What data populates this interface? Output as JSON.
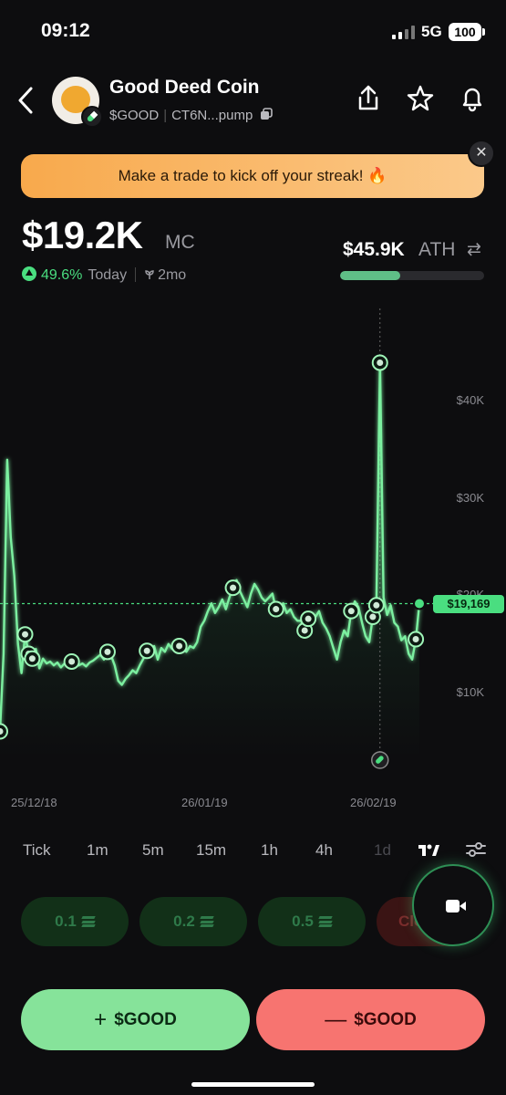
{
  "status_bar": {
    "time": "09:12",
    "network": "5G",
    "battery": "100"
  },
  "coin": {
    "name": "Good Deed Coin",
    "ticker": "$GOOD",
    "address": "CT6N...pump"
  },
  "banner": {
    "text": "Make a trade to kick off your streak! 🔥",
    "close": "✕"
  },
  "market_cap": {
    "value": "$19.2K",
    "label": "MC",
    "change_pct": "49.6%",
    "change_period": "Today",
    "age": "2mo"
  },
  "ath": {
    "value": "$45.9K",
    "label": "ATH",
    "progress": 0.42
  },
  "chart_data": {
    "type": "line",
    "y_ticks": [
      "$40K",
      "$30K",
      "$20K",
      "$10K"
    ],
    "x_ticks": [
      "25/12/18",
      "26/01/19",
      "26/02/19"
    ],
    "ylim": [
      0,
      48000
    ],
    "current_price_label": "$19,169",
    "current_price": 19169,
    "x": [
      0,
      1,
      2,
      3,
      4,
      5,
      6,
      7,
      8,
      9,
      10,
      11,
      12,
      13,
      14,
      15,
      16,
      17,
      18,
      19,
      20,
      21,
      22,
      23,
      24,
      25,
      26,
      27,
      28,
      29,
      30,
      31,
      32,
      33,
      34,
      35,
      36,
      37,
      38,
      39,
      40,
      41,
      42,
      43,
      44,
      45,
      46,
      47,
      48,
      49,
      50,
      51,
      52,
      53,
      54,
      55,
      56,
      57,
      58,
      59,
      60,
      61,
      62,
      63,
      64,
      65,
      66,
      67,
      68,
      69,
      70,
      71,
      72,
      73,
      74,
      75,
      76,
      77,
      78,
      79,
      80,
      81,
      82,
      83,
      84,
      85,
      86,
      87,
      88,
      89,
      90,
      91,
      92,
      93,
      94,
      95,
      96,
      97,
      98,
      99,
      100,
      101,
      102,
      103,
      104,
      105,
      106,
      107,
      108,
      109,
      110,
      111,
      112,
      113,
      114,
      115,
      116,
      117,
      118,
      119,
      120,
      121,
      122,
      123,
      124,
      125,
      126,
      127,
      128,
      129,
      130,
      131,
      132,
      133,
      134
    ],
    "values": [
      6000,
      14000,
      34000,
      26000,
      22000,
      15000,
      12000,
      16000,
      14000,
      13500,
      14500,
      12500,
      13500,
      13000,
      13200,
      12800,
      13100,
      12600,
      13000,
      12900,
      13200,
      13400,
      12800,
      13000,
      12700,
      13100,
      13300,
      13600,
      13900,
      13400,
      14200,
      13800,
      12800,
      11200,
      10800,
      11400,
      11800,
      12300,
      12000,
      12800,
      13500,
      14300,
      13900,
      14800,
      13400,
      14600,
      14200,
      15000,
      14500,
      15200,
      14800,
      14600,
      14200,
      14800,
      14600,
      15200,
      16800,
      17400,
      18400,
      19200,
      18200,
      18800,
      19600,
      18600,
      19800,
      20800,
      21600,
      20400,
      19600,
      18800,
      20200,
      21200,
      20600,
      19800,
      19400,
      19800,
      20200,
      18600,
      18800,
      19200,
      18200,
      18600,
      17800,
      17400,
      17400,
      16400,
      17600,
      18200,
      17800,
      18400,
      17200,
      16600,
      15800,
      14600,
      13400,
      15200,
      16400,
      15800,
      18400,
      19400,
      18800,
      17200,
      15800,
      15200,
      17800,
      19000,
      44000,
      19800,
      18000,
      19000,
      17200,
      16800,
      15400,
      15800,
      14000,
      13400,
      15500,
      19169
    ],
    "type_detail": "line with fill",
    "grid": false
  },
  "timeframes": [
    "Tick",
    "1m",
    "5m",
    "15m",
    "1h",
    "4h",
    "1d"
  ],
  "quick_buy": [
    {
      "label": "0.1"
    },
    {
      "label": "0.2"
    },
    {
      "label": "0.5"
    }
  ],
  "quick_close": "Clos",
  "trade": {
    "buy_label": "$GOOD",
    "sell_label": "$GOOD",
    "buy_sign": "+",
    "sell_sign": "—"
  },
  "colors": {
    "accent_green": "#4ade80",
    "buy": "#86e39a",
    "sell": "#f77470",
    "banner": "#f8a94c"
  }
}
